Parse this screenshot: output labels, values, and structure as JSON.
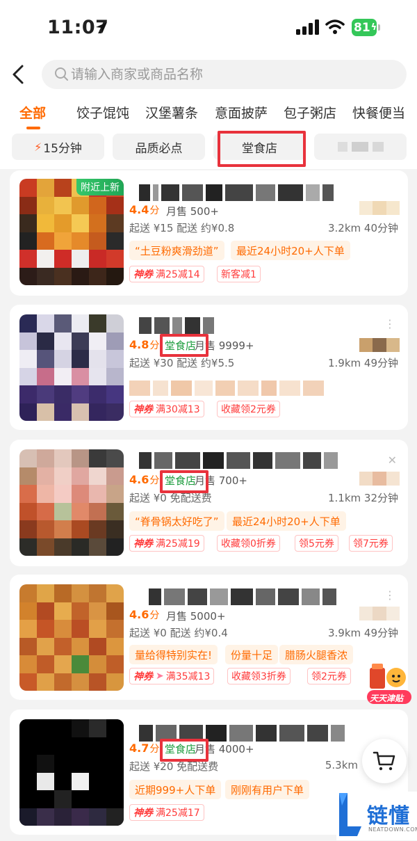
{
  "status_bar": {
    "time": "11:07",
    "battery": "81"
  },
  "search": {
    "placeholder": "请输入商家或商品名称"
  },
  "categories": [
    "全部",
    "饺子馄饨",
    "汉堡薯条",
    "意面披萨",
    "包子粥店",
    "快餐便当"
  ],
  "active_category": "全部",
  "filters": [
    "15分钟",
    "品质必点",
    "堂食店",
    ""
  ],
  "selected_filter": "堂食店",
  "stores": [
    {
      "tag": "附近上新",
      "rating": "4.4",
      "rating_unit": "分",
      "sales": "月售 500+",
      "delivery": "起送 ¥15  配送 约¥0.8",
      "distance": "3.2km  40分钟",
      "chips": [
        "“土豆粉爽滑劲道”",
        "最近24小时20+人下单"
      ],
      "promos": [
        {
          "prefix": "神券",
          "text": "满25减14"
        },
        {
          "prefix": "",
          "text": "新客减1"
        }
      ]
    },
    {
      "badge": "堂食店",
      "rating": "4.8",
      "rating_unit": "分",
      "sales": "月售 9999+",
      "delivery": "起送 ¥30  配送 约¥5.5",
      "distance": "1.9km  49分钟",
      "chips": [],
      "promos": [
        {
          "prefix": "神券",
          "text": "满30减13"
        },
        {
          "prefix": "",
          "text": "收藏领2元券"
        }
      ]
    },
    {
      "badge": "堂食店",
      "rating": "4.6",
      "rating_unit": "分",
      "sales": "月售 700+",
      "delivery": "起送 ¥0  免配送费",
      "distance": "1.1km  32分钟",
      "chips": [
        "“脊骨锅太好吃了”",
        "最近24小时20+人下单"
      ],
      "promos": [
        {
          "prefix": "神券",
          "text": "满25减19"
        },
        {
          "prefix": "",
          "text": "收藏领0折券"
        },
        {
          "prefix": "",
          "text": "领5元券"
        },
        {
          "prefix": "",
          "text": "领7元券"
        }
      ]
    },
    {
      "rating": "4.6",
      "rating_unit": "分",
      "sales": "月售 5000+",
      "delivery": "起送 ¥0  配送 约¥0.4",
      "distance": "3.9km  49分钟",
      "chips": [
        "量给得特别实在!",
        "份量十足",
        "腊肠火腿香浓"
      ],
      "promos": [
        {
          "prefix": "神券",
          "text": "满35减13"
        },
        {
          "prefix": "",
          "text": "收藏领3折券"
        },
        {
          "prefix": "",
          "text": "领2元券"
        }
      ]
    },
    {
      "badge": "堂食店",
      "rating": "4.7",
      "rating_unit": "分",
      "sales": "月售 4000+",
      "delivery": "起送 ¥20  免配送费",
      "distance": "5.3km",
      "chips": [
        "近期999+人下单",
        "刚刚有用户下单"
      ],
      "promos": [
        {
          "prefix": "神券",
          "text": "满25减17"
        }
      ]
    }
  ],
  "floating": {
    "daily_label": "天天津贴"
  },
  "watermark": {
    "brand": "链懂",
    "sub": "NEATDOWN.COM"
  },
  "colors": {
    "accent": "#ff6a00",
    "highlight_box": "#e8323c",
    "badge_green": "#1a9b3b",
    "promo_red": "#ff3b3b"
  }
}
